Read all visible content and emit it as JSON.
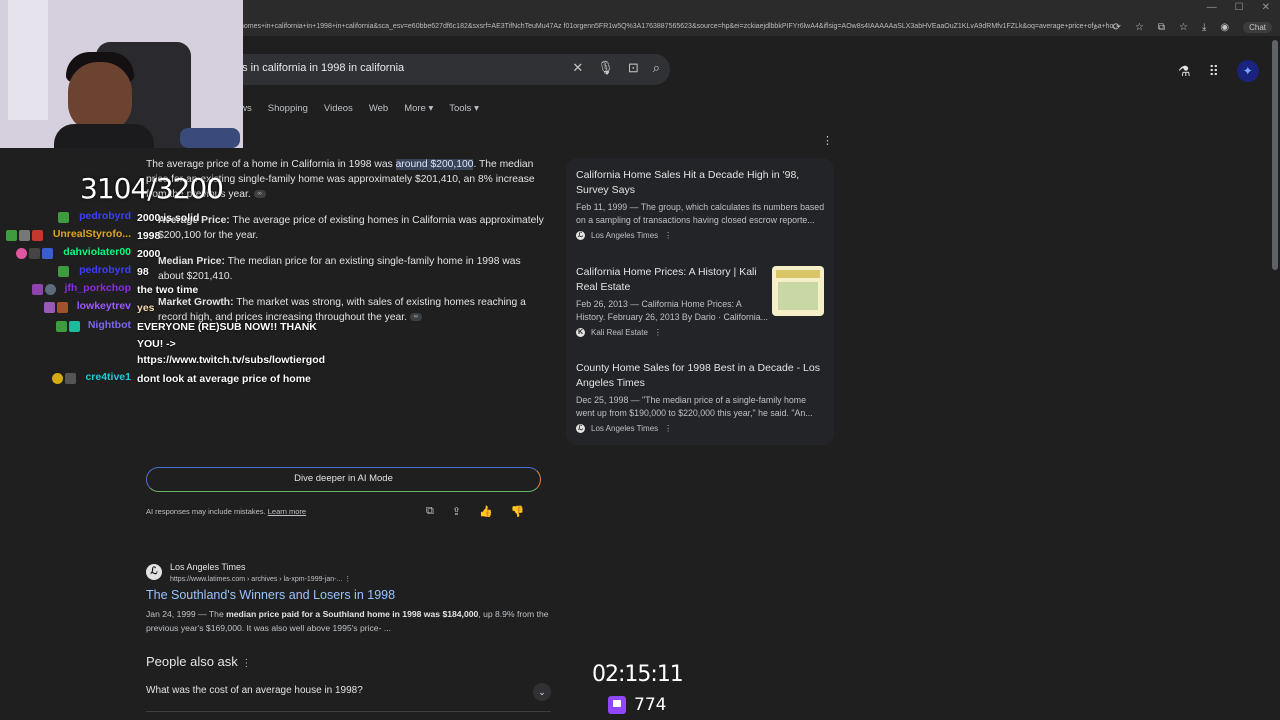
{
  "browser": {
    "url": "homes+in+california+in+1998+in+california&sca_esv=e60bbe627df6c182&sxsrf=AE3TifNchTeuMu47Az f01orgenn5FR1w5Q%3A1763887565623&source=hp&ei=zckiaejdlbbkPIFYr6lwA4&iflsig=AOw8s4IAAAAAaSLX3abHVEaaOuZ1KLvA9dRMfv1FZLk&oq=average+price+of+a+ho...",
    "chat_label": "Chat"
  },
  "search": {
    "query": "es in california in 1998 in california",
    "tabs": [
      "News",
      "Shopping",
      "Videos",
      "Web",
      "More ▾",
      "Tools ▾"
    ]
  },
  "ai_overview": {
    "intro_pre": "The average price of a home in California in 1998 was ",
    "intro_highlight": "around $200,100",
    "intro_post": ". The median price for an existing single-family home was approximately $201,410, an 8% increase from the previous year.",
    "bullets": [
      {
        "label": "Average Price:",
        "text": " The average price of existing homes in California was approximately $200,100 for the year."
      },
      {
        "label": "Median Price:",
        "text": " The median price for an existing single-family home in 1998 was about $201,410."
      },
      {
        "label": "Market Growth:",
        "text": " The market was strong, with sales of existing homes reaching a record high, and prices increasing throughout the year."
      }
    ],
    "dive_button": "Dive deeper in AI Mode",
    "disclaimer": "AI responses may include mistakes.",
    "learn_more": "Learn more"
  },
  "sources": [
    {
      "title": "California Home Sales Hit a Decade High in '98, Survey Says",
      "snippet": "Feb 11, 1999 — The group, which calculates its numbers based on a sampling of transactions having closed escrow reporte...",
      "site": "Los Angeles Times"
    },
    {
      "title": "California Home Prices: A History | Kali Real Estate",
      "snippet": "Feb 26, 2013 — California Home Prices: A History. February 26, 2013 By Dario · California...",
      "site": "Kali Real Estate"
    },
    {
      "title": "County Home Sales for 1998 Best in a Decade - Los Angeles Times",
      "snippet": "Dec 25, 1998 — \"The median price of a single-family home went up from $190,000 to $220,000 this year,\" he said. \"An...",
      "site": "Los Angeles Times"
    }
  ],
  "result": {
    "site": "Los Angeles Times",
    "url": "https://www.latimes.com › archives › la-xpm-1999-jan-...",
    "title": "The Southland's Winners and Losers in 1998",
    "date": "Jan 24, 1999 — The ",
    "snippet_bold": "median price paid for a Southland home in 1998 was $184,000",
    "snippet_rest": ", up 8.9% from the previous year's $169,000. It was also well above 1995's price- ..."
  },
  "people_also_ask": {
    "title": "People also ask",
    "question": "What was the cost of an average house in 1998?"
  },
  "overlay": {
    "counter": "3104/3200",
    "timer": "02:15:11",
    "viewers": "774",
    "chat": [
      {
        "user": "pedrobyrd",
        "color": "#3d3dff",
        "message": "2000 is solid"
      },
      {
        "user": "UnrealStyrofo...",
        "color": "#daa520",
        "message": "1998"
      },
      {
        "user": "dahviolater00",
        "color": "#00ff7f",
        "message": "2000"
      },
      {
        "user": "pedrobyrd",
        "color": "#3d3dff",
        "message": "98"
      },
      {
        "user": "jfh_porkchop",
        "color": "#8a2be2",
        "message": "the two time"
      },
      {
        "user": "lowkeytrev",
        "color": "#9b59ff",
        "message": "yes"
      },
      {
        "user": "Nightbot",
        "color": "#7b68ee",
        "message": "EVERYONE (RE)SUB NOW!! THANK YOU! -> https://www.twitch.tv/subs/lowtiergod"
      },
      {
        "user": "cre4tive1",
        "color": "#1ec8d8",
        "message": "dont look at average price of home"
      }
    ]
  }
}
